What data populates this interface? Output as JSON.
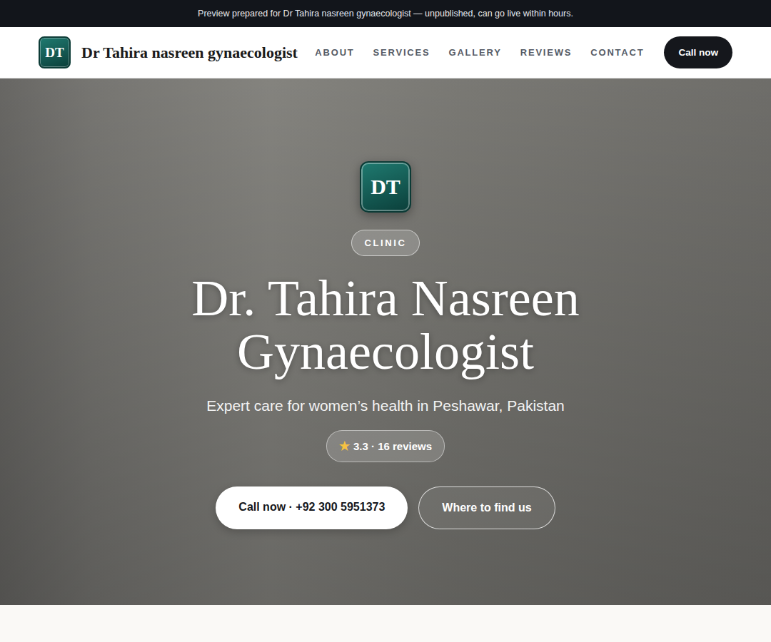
{
  "banner": "Preview prepared for Dr Tahira nasreen gynaecologist — unpublished, can go live within hours.",
  "nav": {
    "logo": "DT",
    "brand": "Dr Tahira nasreen gynaecologist",
    "links": [
      "ABOUT",
      "SERVICES",
      "GALLERY",
      "REVIEWS",
      "CONTACT"
    ],
    "cta": "Call now"
  },
  "hero": {
    "logo": "DT",
    "badge": "CLINIC",
    "title": "Dr. Tahira Nasreen Gynaecologist",
    "subtitle": "Expert care for women’s health in Peshawar, Pakistan",
    "rating": {
      "star": "★",
      "text": "3.3 · 16 reviews"
    },
    "buttons": [
      {
        "label": "Call now · +92 300 5951373",
        "kind": "primary"
      },
      {
        "label": "Where to find us",
        "kind": "secondary"
      }
    ]
  }
}
